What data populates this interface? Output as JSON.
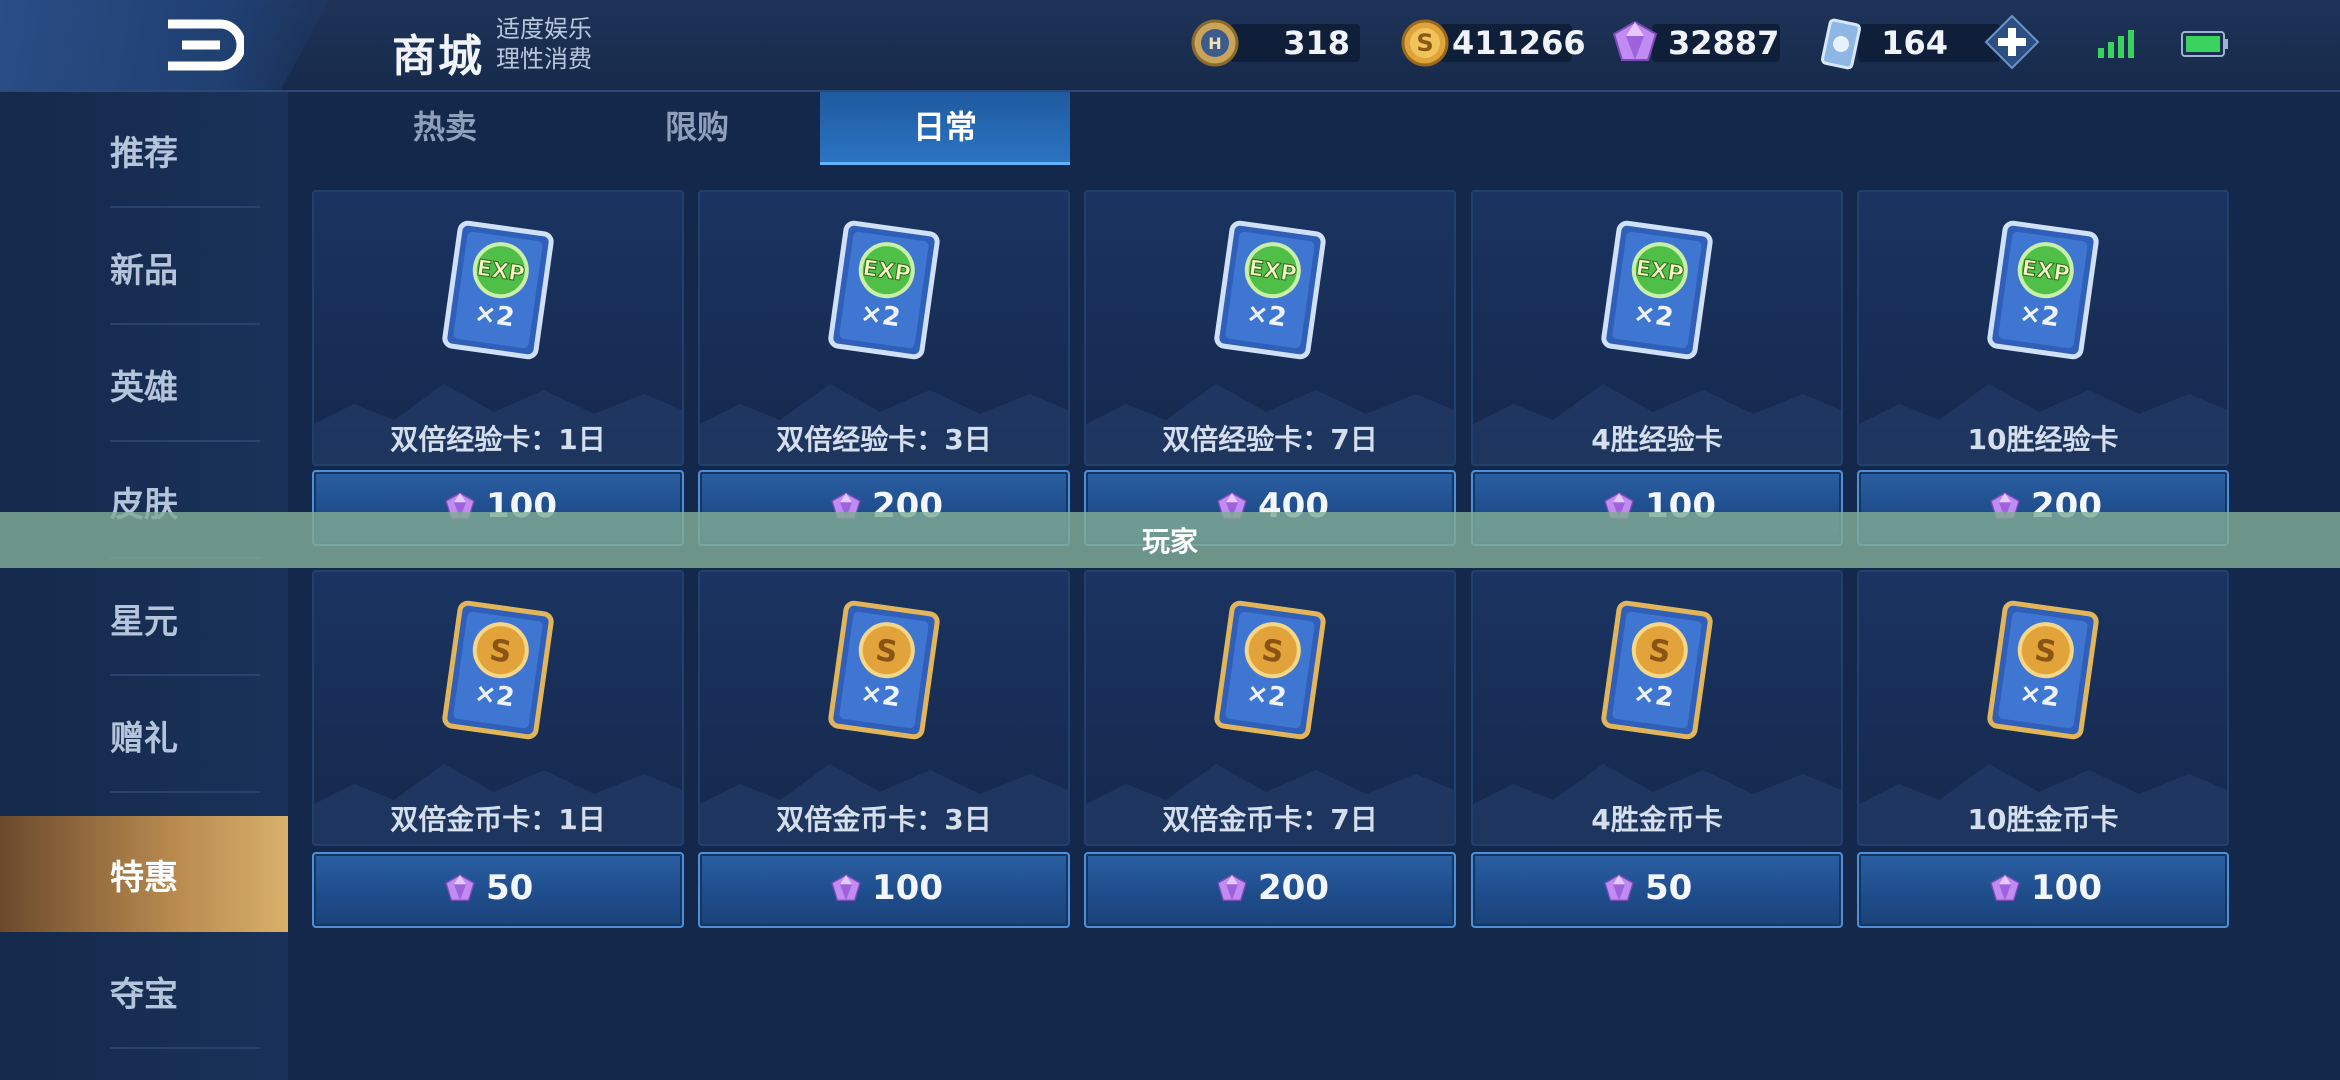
{
  "header": {
    "title": "商城",
    "subtitle_line1": "适度娱乐",
    "subtitle_line2": "理性消费",
    "currencies": [
      {
        "icon": "honor-coin-icon",
        "value": "318"
      },
      {
        "icon": "gold-coin-icon",
        "value": "411266"
      },
      {
        "icon": "diamond-icon",
        "value": "32887"
      },
      {
        "icon": "voucher-icon",
        "value": "164"
      }
    ]
  },
  "sidebar": {
    "items": [
      {
        "label": "推荐"
      },
      {
        "label": "新品"
      },
      {
        "label": "英雄"
      },
      {
        "label": "皮肤"
      },
      {
        "label": "星元"
      },
      {
        "label": "赠礼"
      },
      {
        "label": "特惠",
        "active": true
      },
      {
        "label": "夺宝"
      }
    ]
  },
  "tabs": [
    {
      "label": "热卖"
    },
    {
      "label": "限购"
    },
    {
      "label": "日常",
      "active": true
    }
  ],
  "items": [
    {
      "name": "双倍经验卡：1日",
      "price": "100",
      "type": "exp-card-icon"
    },
    {
      "name": "双倍经验卡：3日",
      "price": "200",
      "type": "exp-card-icon"
    },
    {
      "name": "双倍经验卡：7日",
      "price": "400",
      "type": "exp-card-icon"
    },
    {
      "name": "4胜经验卡",
      "price": "100",
      "type": "exp-card-icon"
    },
    {
      "name": "10胜经验卡",
      "price": "200",
      "type": "exp-card-icon"
    },
    {
      "name": "双倍金币卡：1日",
      "price": "50",
      "type": "gold-card-icon"
    },
    {
      "name": "双倍金币卡：3日",
      "price": "100",
      "type": "gold-card-icon"
    },
    {
      "name": "双倍金币卡：7日",
      "price": "200",
      "type": "gold-card-icon"
    },
    {
      "name": "4胜金币卡",
      "price": "50",
      "type": "gold-card-icon"
    },
    {
      "name": "10胜金币卡",
      "price": "100",
      "type": "gold-card-icon"
    }
  ],
  "card_multiplier": "×2",
  "exp_badge": "EXP",
  "gold_badge": "S",
  "overlay_text": "玩家",
  "colors": {
    "background": "#13284a",
    "active_tab": "#2b74c4",
    "active_side": "#c49a58",
    "diamond": "#c58cf0"
  }
}
